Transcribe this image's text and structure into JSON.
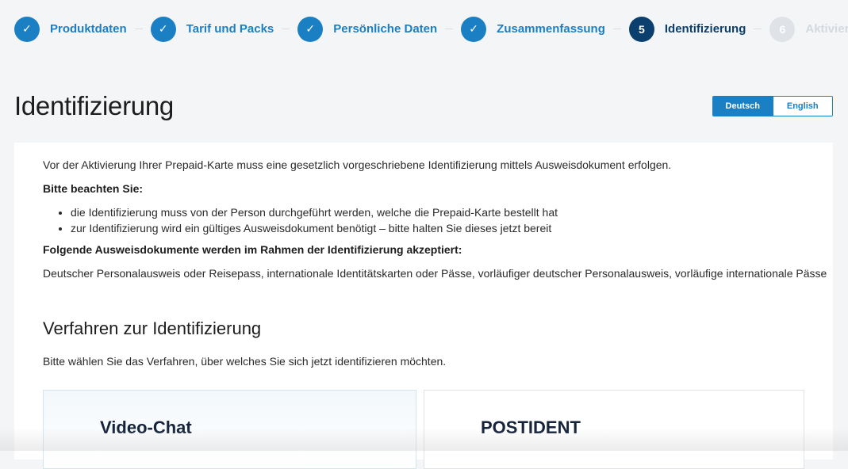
{
  "stepper": {
    "steps": [
      {
        "state": "done",
        "symbol": "✓",
        "label": "Produktdaten"
      },
      {
        "state": "done",
        "symbol": "✓",
        "label": "Tarif und Packs"
      },
      {
        "state": "done",
        "symbol": "✓",
        "label": "Persönliche Daten"
      },
      {
        "state": "done",
        "symbol": "✓",
        "label": "Zusammenfassung"
      },
      {
        "state": "active",
        "symbol": "5",
        "label": "Identifizierung"
      },
      {
        "state": "todo",
        "symbol": "6",
        "label": "Aktivierung"
      }
    ]
  },
  "page": {
    "title": "Identifizierung"
  },
  "language": {
    "options": [
      "Deutsch",
      "English"
    ],
    "selected": "Deutsch"
  },
  "info": {
    "intro": "Vor der Aktivierung Ihrer Prepaid-Karte muss eine gesetzlich vorgeschriebene Identifizierung mittels Ausweisdokument erfolgen.",
    "note_heading": "Bitte beachten Sie:",
    "bullets": [
      "die Identifizierung muss von der Person durchgeführt werden, welche die Prepaid-Karte bestellt hat",
      "zur Identifizierung wird ein gültiges Ausweisdokument benötigt – bitte halten Sie dieses jetzt bereit"
    ],
    "docs_heading": "Folgende Ausweisdokumente werden im Rahmen der Identifizierung akzeptiert:",
    "docs_text": "Deutscher Personalausweis oder Reisepass, internationale Identitätskarten oder Pässe, vorläufiger deutscher Personalausweis, vorläufige internationale Pässe"
  },
  "procedure": {
    "title": "Verfahren zur Identifizierung",
    "instruction": "Bitte wählen Sie das Verfahren, über welches Sie sich jetzt identifizieren möchten.",
    "options": [
      "Video-Chat",
      "POSTIDENT"
    ]
  },
  "colors": {
    "accent": "#1b7fc4",
    "active_step": "#0b3f6e",
    "inactive_step": "#dfe3e8"
  }
}
